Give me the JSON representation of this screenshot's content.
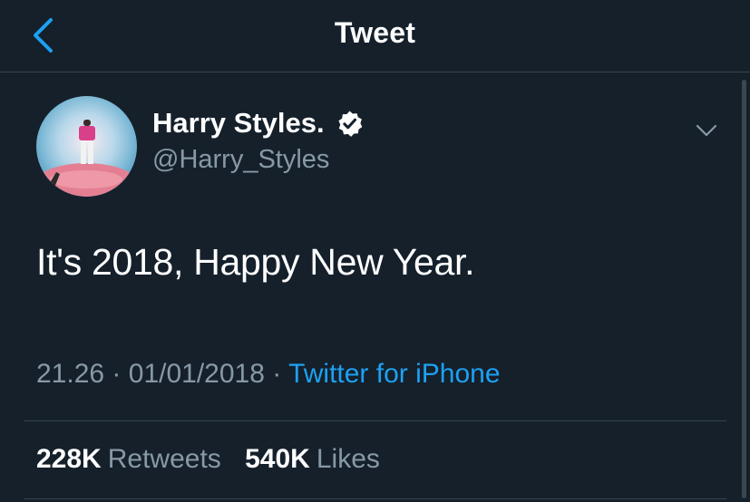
{
  "header": {
    "title": "Tweet"
  },
  "tweet": {
    "display_name": "Harry Styles.",
    "handle": "@Harry_Styles",
    "verified": true,
    "text": "It's 2018, Happy New Year.",
    "time": "21.26",
    "date": "01/01/2018",
    "separator": "·",
    "source": "Twitter for iPhone"
  },
  "stats": {
    "retweets_count": "228K",
    "retweets_label": "Retweets",
    "likes_count": "540K",
    "likes_label": "Likes"
  },
  "colors": {
    "background": "#15202b",
    "accent": "#1da1f2",
    "secondary_text": "#8899a6",
    "divider": "#38444d"
  },
  "icons": {
    "back": "chevron-left-icon",
    "verified": "verified-badge-icon",
    "more": "chevron-down-icon"
  }
}
